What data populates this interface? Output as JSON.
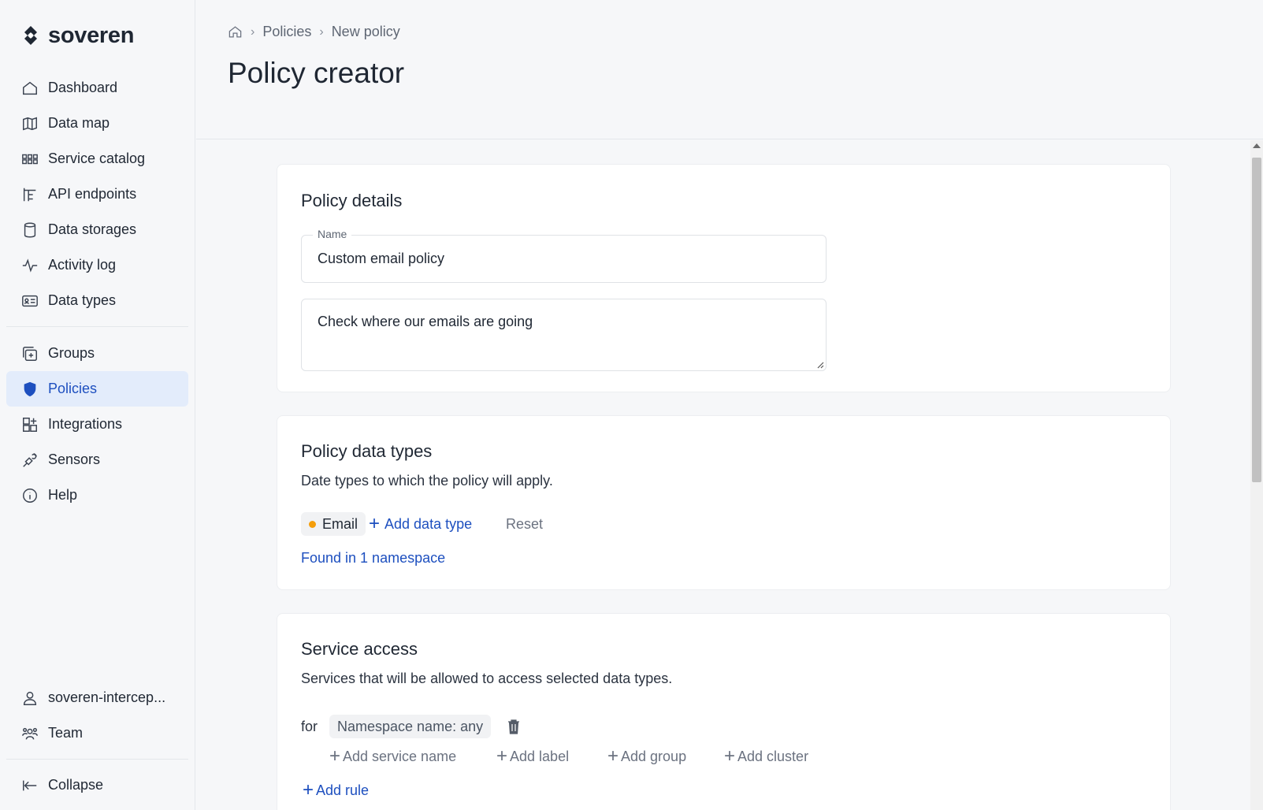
{
  "brand": {
    "name": "soveren"
  },
  "sidebar": {
    "items": [
      {
        "label": "Dashboard",
        "icon": "home-icon"
      },
      {
        "label": "Data map",
        "icon": "map-icon"
      },
      {
        "label": "Service catalog",
        "icon": "grid-icon"
      },
      {
        "label": "API endpoints",
        "icon": "api-icon"
      },
      {
        "label": "Data storages",
        "icon": "database-icon"
      },
      {
        "label": "Activity log",
        "icon": "activity-icon"
      },
      {
        "label": "Data types",
        "icon": "id-card-icon"
      }
    ],
    "items2": [
      {
        "label": "Groups",
        "icon": "groups-icon"
      },
      {
        "label": "Policies",
        "icon": "shield-icon",
        "active": true
      },
      {
        "label": "Integrations",
        "icon": "integrations-icon"
      },
      {
        "label": "Sensors",
        "icon": "sensor-icon"
      },
      {
        "label": "Help",
        "icon": "info-icon"
      }
    ],
    "bottom": [
      {
        "label": "soveren-intercep...",
        "icon": "user-icon"
      },
      {
        "label": "Team",
        "icon": "team-icon"
      }
    ],
    "collapse": {
      "label": "Collapse",
      "icon": "collapse-icon"
    }
  },
  "breadcrumb": {
    "items": [
      "Policies",
      "New policy"
    ]
  },
  "page": {
    "title": "Policy creator"
  },
  "policy_details": {
    "title": "Policy details",
    "name_label": "Name",
    "name_value": "Custom email policy",
    "description_value": "Check where our emails are going"
  },
  "policy_data_types": {
    "title": "Policy data types",
    "subtitle": "Date types to which the policy will apply.",
    "chip": {
      "label": "Email",
      "color": "#f59e0b"
    },
    "add_label": "Add data type",
    "reset_label": "Reset",
    "found_label": "Found in 1 namespace"
  },
  "service_access": {
    "title": "Service access",
    "subtitle": "Services that will be allowed to access selected data types.",
    "for_label": "for",
    "namespace_chip": "Namespace name: any",
    "actions": [
      "Add service name",
      "Add label",
      "Add group",
      "Add cluster"
    ],
    "add_rule_label": "Add rule"
  },
  "colors": {
    "accent": "#1d4fbf",
    "active_bg": "#e3ecfb",
    "email_dot": "#f59e0b"
  }
}
